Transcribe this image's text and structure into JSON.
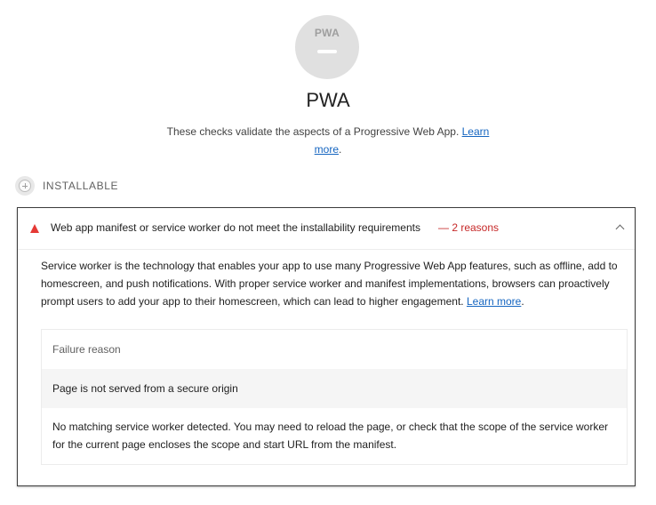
{
  "category": {
    "gauge_label": "PWA",
    "title": "PWA",
    "description": "These checks validate the aspects of a Progressive Web App.",
    "learn_more": "Learn more",
    "period": "."
  },
  "group": {
    "label": "INSTALLABLE",
    "icon": "plus-circle-icon"
  },
  "audit": {
    "status_icon": "warning-triangle-icon",
    "status_color": "#e53935",
    "title": "Web app manifest or service worker do not meet the installability requirements",
    "reasons": "— 2 reasons",
    "description": "Service worker is the technology that enables your app to use many Progressive Web App features, such as offline, add to homescreen, and push notifications. With proper service worker and manifest implementations, browsers can proactively prompt users to add your app to their homescreen, which can lead to higher engagement.",
    "learn_more": "Learn more",
    "period": ".",
    "table": {
      "header": "Failure reason",
      "rows": [
        "Page is not served from a secure origin",
        "No matching service worker detected. You may need to reload the page, or check that the scope of the service worker for the current page encloses the scope and start URL from the manifest."
      ]
    }
  }
}
